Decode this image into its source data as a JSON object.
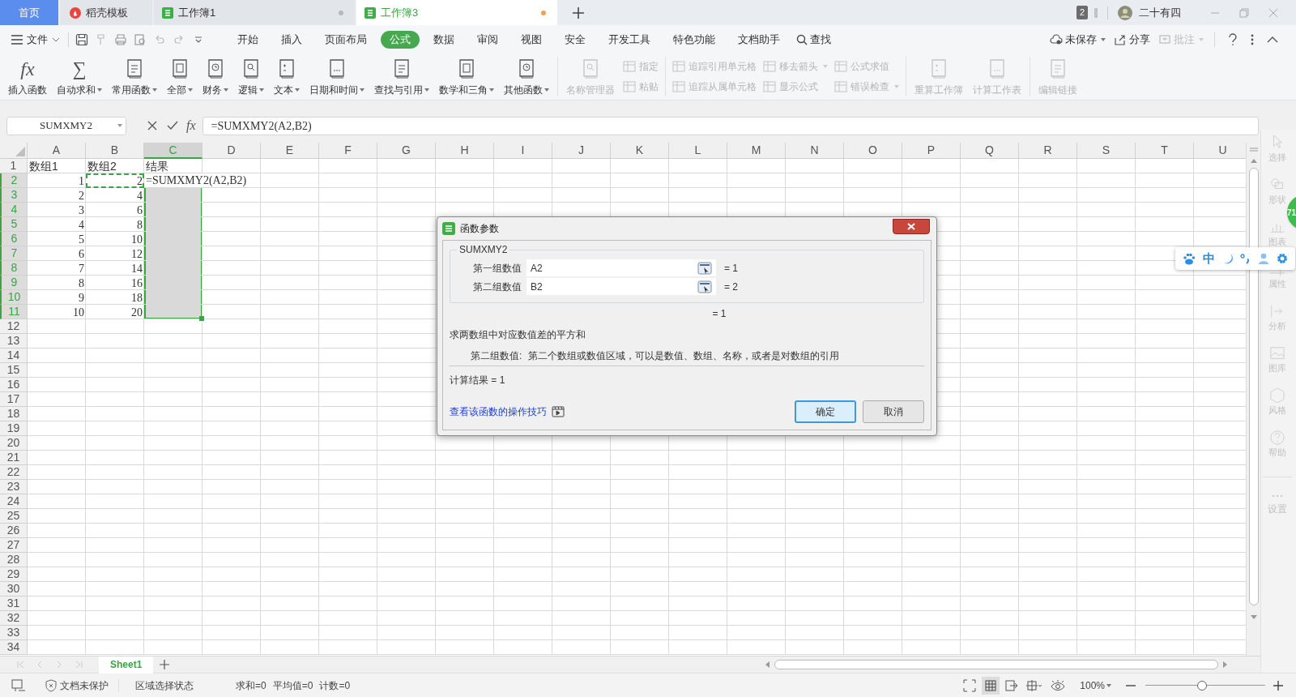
{
  "tabs": [
    {
      "label": "首页",
      "kind": "home",
      "selected": false,
      "unsaved": false
    },
    {
      "label": "稻壳模板",
      "kind": "docer",
      "selected": false,
      "unsaved": false
    },
    {
      "label": "工作簿1",
      "kind": "sheet",
      "selected": false,
      "unsaved": true
    },
    {
      "label": "工作簿3",
      "kind": "sheet",
      "selected": true,
      "unsaved": true
    }
  ],
  "title_bar": {
    "badge": "2",
    "user": "二十有四"
  },
  "menu": {
    "file": "文件",
    "tabs": [
      {
        "label": "开始",
        "selected": false
      },
      {
        "label": "插入",
        "selected": false
      },
      {
        "label": "页面布局",
        "selected": false
      },
      {
        "label": "公式",
        "selected": true
      },
      {
        "label": "数据",
        "selected": false
      },
      {
        "label": "审阅",
        "selected": false
      },
      {
        "label": "视图",
        "selected": false
      },
      {
        "label": "安全",
        "selected": false
      },
      {
        "label": "开发工具",
        "selected": false
      },
      {
        "label": "特色功能",
        "selected": false
      },
      {
        "label": "文档助手",
        "selected": false
      }
    ],
    "search": "查找",
    "actions": [
      {
        "label": "未保存",
        "dropdown": true,
        "disabled": false
      },
      {
        "label": "分享",
        "dropdown": false,
        "disabled": false
      },
      {
        "label": "批注",
        "dropdown": true,
        "disabled": true
      }
    ]
  },
  "ribbon": {
    "groups": [
      {
        "columns": [
          {
            "kind": "large",
            "items": [
              {
                "label": "插入函数",
                "glyph": "fx",
                "dropdown": false,
                "disabled": false
              }
            ]
          },
          {
            "kind": "large",
            "items": [
              {
                "label": "自动求和",
                "glyph": "∑",
                "dropdown": true,
                "disabled": false
              }
            ]
          },
          {
            "kind": "large",
            "items": [
              {
                "label": "常用函数",
                "dropdown": true,
                "disabled": false
              }
            ]
          },
          {
            "kind": "large",
            "items": [
              {
                "label": "全部",
                "dropdown": true,
                "disabled": false
              }
            ]
          },
          {
            "kind": "large",
            "items": [
              {
                "label": "财务",
                "dropdown": true,
                "disabled": false
              }
            ]
          },
          {
            "kind": "large",
            "items": [
              {
                "label": "逻辑",
                "dropdown": true,
                "disabled": false
              }
            ]
          },
          {
            "kind": "large",
            "items": [
              {
                "label": "文本",
                "dropdown": true,
                "disabled": false
              }
            ]
          },
          {
            "kind": "large",
            "items": [
              {
                "label": "日期和时间",
                "dropdown": true,
                "disabled": false
              }
            ]
          },
          {
            "kind": "large",
            "items": [
              {
                "label": "查找与引用",
                "dropdown": true,
                "disabled": false
              }
            ]
          },
          {
            "kind": "large",
            "items": [
              {
                "label": "数学和三角",
                "dropdown": true,
                "disabled": false
              }
            ]
          },
          {
            "kind": "large",
            "items": [
              {
                "label": "其他函数",
                "dropdown": true,
                "disabled": false
              }
            ]
          }
        ]
      },
      {
        "columns": [
          {
            "kind": "large",
            "items": [
              {
                "label": "名称管理器",
                "dropdown": false,
                "disabled": true
              }
            ]
          },
          {
            "kind": "stack",
            "items": [
              {
                "label": "指定",
                "dropdown": false,
                "disabled": true
              },
              {
                "label": "粘贴",
                "dropdown": false,
                "disabled": true
              }
            ]
          }
        ]
      },
      {
        "columns": [
          {
            "kind": "stack",
            "items": [
              {
                "label": "追踪引用单元格",
                "dropdown": false,
                "disabled": true
              },
              {
                "label": "追踪从属单元格",
                "dropdown": false,
                "disabled": true
              }
            ]
          },
          {
            "kind": "stack",
            "items": [
              {
                "label": "移去箭头",
                "dropdown": true,
                "disabled": true
              },
              {
                "label": "显示公式",
                "dropdown": false,
                "disabled": true
              }
            ]
          },
          {
            "kind": "stack",
            "items": [
              {
                "label": "公式求值",
                "dropdown": false,
                "disabled": true
              },
              {
                "label": "错误检查",
                "dropdown": true,
                "disabled": true
              }
            ]
          }
        ]
      },
      {
        "columns": [
          {
            "kind": "large",
            "items": [
              {
                "label": "重算工作簿",
                "dropdown": false,
                "disabled": true
              }
            ]
          },
          {
            "kind": "large",
            "items": [
              {
                "label": "计算工作表",
                "dropdown": false,
                "disabled": true
              }
            ]
          }
        ]
      },
      {
        "columns": [
          {
            "kind": "large",
            "items": [
              {
                "label": "编辑链接",
                "dropdown": false,
                "disabled": true
              }
            ]
          }
        ]
      }
    ]
  },
  "formula_bar": {
    "name_box": "SUMXMY2",
    "fx": "fx",
    "formula": "=SUMXMY2(A2,B2)"
  },
  "sheet": {
    "columns": [
      {
        "label": "A",
        "selected": false
      },
      {
        "label": "B",
        "selected": false
      },
      {
        "label": "C",
        "selected": true
      },
      {
        "label": "D",
        "selected": false
      },
      {
        "label": "E",
        "selected": false
      },
      {
        "label": "F",
        "selected": false
      },
      {
        "label": "G",
        "selected": false
      },
      {
        "label": "H",
        "selected": false
      },
      {
        "label": "I",
        "selected": false
      },
      {
        "label": "J",
        "selected": false
      },
      {
        "label": "K",
        "selected": false
      },
      {
        "label": "L",
        "selected": false
      },
      {
        "label": "M",
        "selected": false
      },
      {
        "label": "N",
        "selected": false
      },
      {
        "label": "O",
        "selected": false
      },
      {
        "label": "P",
        "selected": false
      },
      {
        "label": "Q",
        "selected": false
      },
      {
        "label": "R",
        "selected": false
      },
      {
        "label": "S",
        "selected": false
      },
      {
        "label": "T",
        "selected": false
      },
      {
        "label": "U",
        "selected": false
      }
    ],
    "rows": [
      {
        "number": "1",
        "selected": false,
        "cells": [
          {
            "text": "数组1",
            "kind": "text",
            "active": false,
            "marquee": false
          },
          {
            "text": "数组2",
            "kind": "text",
            "active": false,
            "marquee": false
          },
          {
            "text": "结果",
            "kind": "text",
            "active": false,
            "marquee": false
          }
        ]
      },
      {
        "number": "2",
        "selected": true,
        "cells": [
          {
            "text": "1",
            "kind": "number",
            "active": false,
            "marquee": false
          },
          {
            "text": "2",
            "kind": "number",
            "active": false,
            "marquee": true
          },
          {
            "text": "=SUMXMY2(A2,B2)",
            "kind": "formula",
            "active": true,
            "marquee": false
          }
        ]
      },
      {
        "number": "3",
        "selected": true,
        "cells": [
          {
            "text": "2",
            "kind": "number",
            "active": false,
            "marquee": false
          },
          {
            "text": "4",
            "kind": "number",
            "active": false,
            "marquee": false
          }
        ]
      },
      {
        "number": "4",
        "selected": true,
        "cells": [
          {
            "text": "3",
            "kind": "number",
            "active": false,
            "marquee": false
          },
          {
            "text": "6",
            "kind": "number",
            "active": false,
            "marquee": false
          }
        ]
      },
      {
        "number": "5",
        "selected": true,
        "cells": [
          {
            "text": "4",
            "kind": "number",
            "active": false,
            "marquee": false
          },
          {
            "text": "8",
            "kind": "number",
            "active": false,
            "marquee": false
          }
        ]
      },
      {
        "number": "6",
        "selected": true,
        "cells": [
          {
            "text": "5",
            "kind": "number",
            "active": false,
            "marquee": false
          },
          {
            "text": "10",
            "kind": "number",
            "active": false,
            "marquee": false
          }
        ]
      },
      {
        "number": "7",
        "selected": true,
        "cells": [
          {
            "text": "6",
            "kind": "number",
            "active": false,
            "marquee": false
          },
          {
            "text": "12",
            "kind": "number",
            "active": false,
            "marquee": false
          }
        ]
      },
      {
        "number": "8",
        "selected": true,
        "cells": [
          {
            "text": "7",
            "kind": "number",
            "active": false,
            "marquee": false
          },
          {
            "text": "14",
            "kind": "number",
            "active": false,
            "marquee": false
          }
        ]
      },
      {
        "number": "9",
        "selected": true,
        "cells": [
          {
            "text": "8",
            "kind": "number",
            "active": false,
            "marquee": false
          },
          {
            "text": "16",
            "kind": "number",
            "active": false,
            "marquee": false
          }
        ]
      },
      {
        "number": "10",
        "selected": true,
        "cells": [
          {
            "text": "9",
            "kind": "number",
            "active": false,
            "marquee": false
          },
          {
            "text": "18",
            "kind": "number",
            "active": false,
            "marquee": false
          }
        ]
      },
      {
        "number": "11",
        "selected": true,
        "cells": [
          {
            "text": "10",
            "kind": "number",
            "active": false,
            "marquee": false
          },
          {
            "text": "20",
            "kind": "number",
            "active": false,
            "marquee": false
          }
        ]
      },
      {
        "number": "12",
        "selected": false
      },
      {
        "number": "13",
        "selected": false
      },
      {
        "number": "14",
        "selected": false
      },
      {
        "number": "15",
        "selected": false
      },
      {
        "number": "16",
        "selected": false
      },
      {
        "number": "17",
        "selected": false
      },
      {
        "number": "18",
        "selected": false
      },
      {
        "number": "19",
        "selected": false
      },
      {
        "number": "20",
        "selected": false
      },
      {
        "number": "21",
        "selected": false
      },
      {
        "number": "22",
        "selected": false
      },
      {
        "number": "23",
        "selected": false
      },
      {
        "number": "24",
        "selected": false
      },
      {
        "number": "25",
        "selected": false
      },
      {
        "number": "26",
        "selected": false
      },
      {
        "number": "27",
        "selected": false
      },
      {
        "number": "28",
        "selected": false
      },
      {
        "number": "29",
        "selected": false
      },
      {
        "number": "30",
        "selected": false
      },
      {
        "number": "31",
        "selected": false
      },
      {
        "number": "32",
        "selected": false
      },
      {
        "number": "33",
        "selected": false
      },
      {
        "number": "34",
        "selected": false
      }
    ]
  },
  "dialog": {
    "title": "函数参数",
    "function": "SUMXMY2",
    "args": [
      {
        "label": "第一组数值",
        "value": "A2",
        "result": "= 1"
      },
      {
        "label": "第二组数值",
        "value": "B2",
        "result": "= 2"
      }
    ],
    "result": "= 1",
    "description": "求两数组中对应数值差的平方和",
    "arg_help_label": "第二组数值:",
    "arg_help": "第二个数组或数值区域，可以是数值、数组、名称，或者是对数组的引用",
    "calc_result": "计算结果 = 1",
    "link": "查看该函数的操作技巧",
    "buttons": [
      {
        "label": "确定",
        "default": true
      },
      {
        "label": "取消",
        "default": false
      }
    ]
  },
  "side_panel": {
    "items": [
      {
        "label": "选择",
        "disabled": true
      },
      {
        "label": "形状",
        "disabled": true
      },
      {
        "label": "图表",
        "disabled": true
      },
      {
        "label": "属性",
        "disabled": true
      },
      {
        "label": "分析",
        "disabled": true
      },
      {
        "label": "图库",
        "disabled": true
      },
      {
        "label": "风格",
        "disabled": true
      },
      {
        "label": "帮助",
        "disabled": true
      }
    ],
    "settings": "设置"
  },
  "floating_ball": "71",
  "ime_toolbar": {
    "mode": "中"
  },
  "sheet_tabs": [
    {
      "label": "Sheet1",
      "selected": true
    }
  ],
  "status_bar": {
    "protection": "文档未保护",
    "mode": "区域选择状态",
    "stats": [
      "求和=0",
      "平均值=0",
      "计数=0"
    ],
    "zoom": "100%",
    "zoom_slider": {
      "level": 0.47
    }
  }
}
